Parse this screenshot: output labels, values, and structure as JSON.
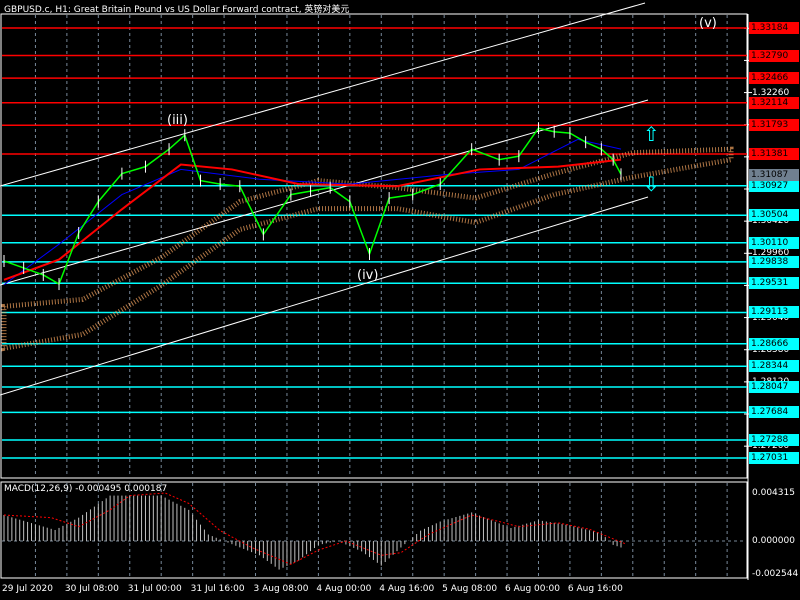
{
  "window": {
    "title": "GBPUSD.c, H1:  Great Britain Pound vs US Dollar Forward contract, 英镑对美元"
  },
  "colors": {
    "background": "#000000",
    "grid": "#778899",
    "red_level": "#ff0000",
    "cyan_level": "#00ffff",
    "candle": "#00ff00",
    "ma_red": "#ff0000",
    "ma_blue": "#0000ff",
    "cloud": "#f4a460",
    "channel": "#ffffff"
  },
  "price_axis": {
    "ticks": [
      "1.33180",
      "1.32720",
      "1.32260",
      "1.31800",
      "1.31340",
      "1.30880",
      "1.30420",
      "1.29960",
      "1.29500",
      "1.29040",
      "1.28580",
      "1.28120",
      "1.27660",
      "1.27200"
    ],
    "current_price": "1.31087",
    "red_levels": [
      "1.33184",
      "1.32790",
      "1.32466",
      "1.32114",
      "1.31793",
      "1.31381"
    ],
    "cyan_levels": [
      "1.30927",
      "1.30504",
      "1.30110",
      "1.29838",
      "1.29531",
      "1.29113",
      "1.28666",
      "1.28344",
      "1.28047",
      "1.27684",
      "1.27288",
      "1.27031"
    ]
  },
  "time_axis": {
    "labels": [
      "29 Jul 2020",
      "30 Jul 08:00",
      "31 Jul 00:00",
      "31 Jul 16:00",
      "3 Aug 08:00",
      "4 Aug 00:00",
      "4 Aug 16:00",
      "5 Aug 08:00",
      "6 Aug 00:00",
      "6 Aug 16:00"
    ],
    "label_hours": [
      0,
      16,
      32,
      48,
      64,
      80,
      96,
      112,
      128,
      144
    ]
  },
  "waves": {
    "iii": "(iii)",
    "iv": "(iv)",
    "v": "(v)"
  },
  "macd": {
    "title": "MACD(12,26,9) -0.000495 0.000187",
    "axis": [
      "0.004315",
      "0.000000",
      "-0.002544"
    ]
  },
  "chart_data": {
    "type": "line",
    "price_series": [
      [
        0,
        1.2985
      ],
      [
        5,
        1.2975
      ],
      [
        10,
        1.2965
      ],
      [
        14,
        1.2952
      ],
      [
        19,
        1.3025
      ],
      [
        24,
        1.307
      ],
      [
        30,
        1.311
      ],
      [
        36,
        1.312
      ],
      [
        42,
        1.3145
      ],
      [
        46,
        1.3165
      ],
      [
        50,
        1.31
      ],
      [
        55,
        1.3095
      ],
      [
        60,
        1.3092
      ],
      [
        66,
        1.3023
      ],
      [
        73,
        1.308
      ],
      [
        78,
        1.3085
      ],
      [
        83,
        1.309
      ],
      [
        88,
        1.307
      ],
      [
        93,
        1.2995
      ],
      [
        98,
        1.3075
      ],
      [
        104,
        1.308
      ],
      [
        111,
        1.3095
      ],
      [
        119,
        1.3145
      ],
      [
        126,
        1.313
      ],
      [
        131,
        1.3135
      ],
      [
        136,
        1.3175
      ],
      [
        140,
        1.317
      ],
      [
        144,
        1.3168
      ],
      [
        148,
        1.3155
      ],
      [
        152,
        1.3145
      ],
      [
        155,
        1.313
      ],
      [
        157,
        1.3109
      ]
    ],
    "ma_red": [
      [
        0,
        1.2958
      ],
      [
        14,
        1.2987
      ],
      [
        30,
        1.3059
      ],
      [
        45,
        1.3123
      ],
      [
        58,
        1.3116
      ],
      [
        75,
        1.3095
      ],
      [
        100,
        1.3092
      ],
      [
        121,
        1.3116
      ],
      [
        141,
        1.312
      ],
      [
        157,
        1.313
      ]
    ],
    "ma_blue": [
      [
        0,
        1.2951
      ],
      [
        14,
        1.3009
      ],
      [
        30,
        1.308
      ],
      [
        45,
        1.3116
      ],
      [
        65,
        1.3102
      ],
      [
        88,
        1.3095
      ],
      [
        113,
        1.3109
      ],
      [
        131,
        1.3116
      ],
      [
        146,
        1.3159
      ],
      [
        157,
        1.3145
      ]
    ],
    "cloud_upper": [
      [
        0,
        1.292
      ],
      [
        20,
        1.293
      ],
      [
        40,
        1.299
      ],
      [
        60,
        1.307
      ],
      [
        80,
        1.31
      ],
      [
        100,
        1.309
      ],
      [
        120,
        1.3075
      ],
      [
        140,
        1.311
      ],
      [
        160,
        1.314
      ],
      [
        185,
        1.3145
      ]
    ],
    "cloud_lower": [
      [
        0,
        1.286
      ],
      [
        20,
        1.288
      ],
      [
        40,
        1.295
      ],
      [
        60,
        1.303
      ],
      [
        80,
        1.306
      ],
      [
        100,
        1.306
      ],
      [
        120,
        1.304
      ],
      [
        140,
        1.308
      ],
      [
        160,
        1.3105
      ],
      [
        185,
        1.313
      ]
    ],
    "macd_histogram": [
      [
        0,
        0.002
      ],
      [
        13,
        0.00085
      ],
      [
        19,
        0.0018
      ],
      [
        27,
        0.0035
      ],
      [
        40,
        0.0035
      ],
      [
        47,
        0.0024
      ],
      [
        52,
        0.0005
      ],
      [
        56,
        0.0
      ],
      [
        65,
        -0.0011
      ],
      [
        70,
        -0.0022
      ],
      [
        75,
        -0.0015
      ],
      [
        80,
        -0.0003
      ],
      [
        85,
        0.0
      ],
      [
        91,
        -0.0008
      ],
      [
        96,
        -0.0019
      ],
      [
        101,
        -0.0005
      ],
      [
        106,
        0.0008
      ],
      [
        111,
        0.0015
      ],
      [
        119,
        0.0022
      ],
      [
        124,
        0.0016
      ],
      [
        129,
        0.001
      ],
      [
        136,
        0.0016
      ],
      [
        144,
        0.0012
      ],
      [
        152,
        0.0006
      ],
      [
        155,
        -0.0003
      ],
      [
        157,
        -0.0005
      ]
    ],
    "macd_signal": [
      [
        0,
        0.002
      ],
      [
        12,
        0.0018
      ],
      [
        19,
        0.0011
      ],
      [
        27,
        0.0024
      ],
      [
        32,
        0.0035
      ],
      [
        41,
        0.0037
      ],
      [
        47,
        0.0029
      ],
      [
        55,
        0.0008
      ],
      [
        63,
        -0.0005
      ],
      [
        73,
        -0.0018
      ],
      [
        80,
        -0.0007
      ],
      [
        87,
        0.0
      ],
      [
        96,
        -0.0011
      ],
      [
        101,
        -0.0009
      ],
      [
        108,
        0.0005
      ],
      [
        119,
        0.002
      ],
      [
        126,
        0.0015
      ],
      [
        131,
        0.0011
      ],
      [
        141,
        0.0014
      ],
      [
        149,
        0.0009
      ],
      [
        158,
        -0.0002
      ]
    ]
  }
}
